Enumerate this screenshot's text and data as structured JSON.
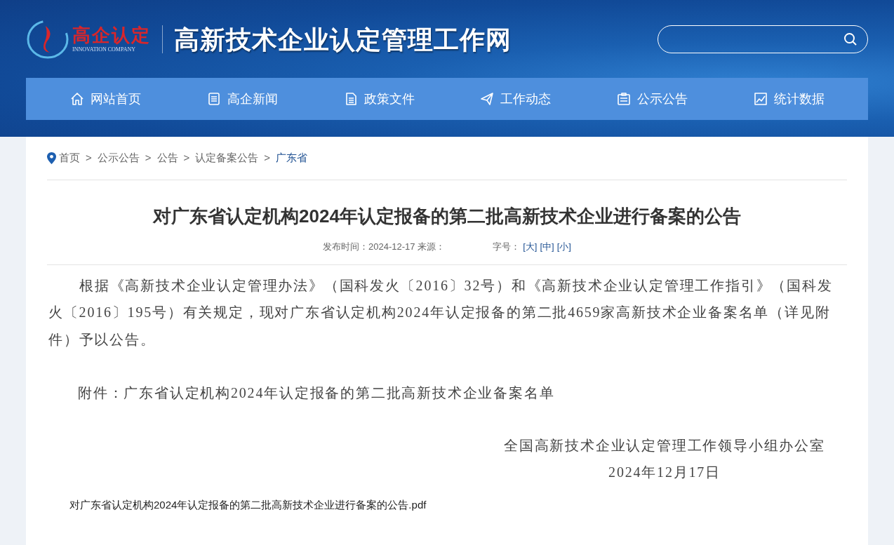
{
  "header": {
    "logo_title": "高企认定",
    "logo_subtitle": "INNOVATION COMPANY",
    "site_title": "高新技术企业认定管理工作网"
  },
  "nav": [
    {
      "label": "网站首页",
      "kind": "home"
    },
    {
      "label": "高企新闻",
      "kind": "news"
    },
    {
      "label": "政策文件",
      "kind": "doc"
    },
    {
      "label": "工作动态",
      "kind": "send"
    },
    {
      "label": "公示公告",
      "kind": "board"
    },
    {
      "label": "统计数据",
      "kind": "chart"
    }
  ],
  "breadcrumb": [
    {
      "text": "首页",
      "kind": "link"
    },
    {
      "text": ">",
      "kind": "sep"
    },
    {
      "text": "公示公告",
      "kind": "link"
    },
    {
      "text": ">",
      "kind": "sep"
    },
    {
      "text": "公告",
      "kind": "link"
    },
    {
      "text": ">",
      "kind": "sep"
    },
    {
      "text": "认定备案公告",
      "kind": "link"
    },
    {
      "text": ">",
      "kind": "sep"
    },
    {
      "text": "广东省",
      "kind": "current"
    }
  ],
  "article": {
    "title": "对广东省认定机构2024年认定报备的第二批高新技术企业进行备案的公告",
    "meta": "发布时间：2024-12-17 来源：",
    "font_size_label": "字号：",
    "font_sizes": [
      "[大]",
      "[中]",
      "[小]"
    ],
    "paragraphs": [
      "根据《高新技术企业认定管理办法》（国科发火〔2016〕32号）和《高新技术企业认定管理工作指引》（国科发火〔2016〕195号）有关规定，现对广东省认定机构2024年认定报备的第二批4659家高新技术企业备案名单（详见附件）予以公告。"
    ],
    "attachment_note": "附件：广东省认定机构2024年认定报备的第二批高新技术企业备案名单",
    "signature": [
      "全国高新技术企业认定管理工作领导小组办公室",
      "2024年12月17日"
    ],
    "attachment_link": "对广东省认定机构2024年认定报备的第二批高新技术企业进行备案的公告.pdf"
  }
}
